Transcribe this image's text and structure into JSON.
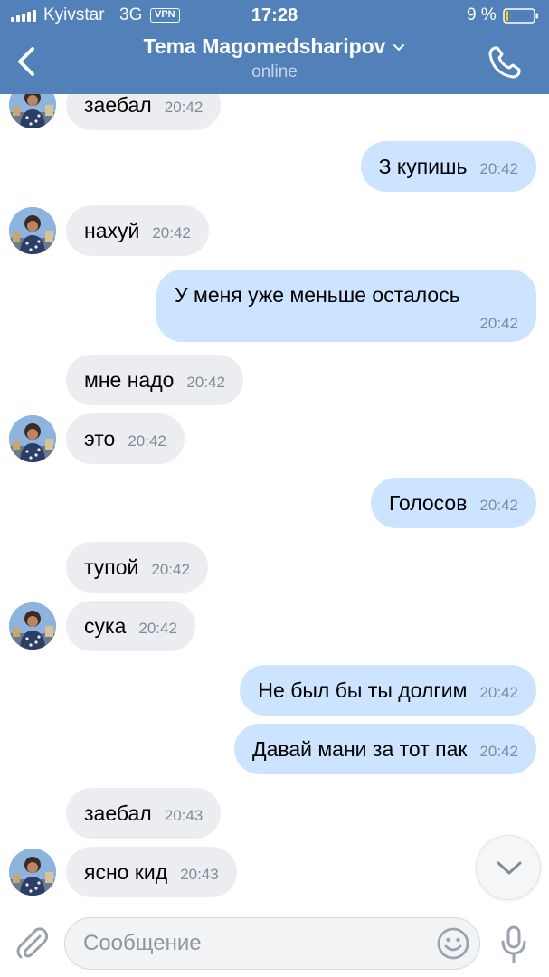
{
  "status_bar": {
    "carrier": "Kyivstar",
    "network": "3G",
    "vpn": "VPN",
    "time": "17:28",
    "battery": "9 %"
  },
  "header": {
    "contact_name": "Tema Magomedsharipov",
    "status": "online",
    "back_icon": "chevron-left-icon",
    "call_icon": "phone-icon"
  },
  "messages": [
    {
      "direction": "in",
      "text": "заебал",
      "time": "20:42",
      "avatar": true
    },
    {
      "direction": "out",
      "text": "З купишь",
      "time": "20:42"
    },
    {
      "direction": "in",
      "text": "нахуй",
      "time": "20:42",
      "avatar": true
    },
    {
      "direction": "out",
      "text": "У меня уже меньше осталось",
      "time": "20:42"
    },
    {
      "direction": "in",
      "text": "мне надо",
      "time": "20:42"
    },
    {
      "direction": "in",
      "text": "это",
      "time": "20:42",
      "avatar": true
    },
    {
      "direction": "out",
      "text": "Голосов",
      "time": "20:42"
    },
    {
      "direction": "in",
      "text": "тупой",
      "time": "20:42"
    },
    {
      "direction": "in",
      "text": "сука",
      "time": "20:42",
      "avatar": true
    },
    {
      "direction": "out",
      "text": "Не был бы ты долгим",
      "time": "20:42"
    },
    {
      "direction": "out",
      "text": "Давай мани за тот пак",
      "time": "20:42"
    },
    {
      "direction": "in",
      "text": "заебал",
      "time": "20:43"
    },
    {
      "direction": "in",
      "text": "ясно кид",
      "time": "20:43",
      "avatar": true
    }
  ],
  "composer": {
    "placeholder": "Сообщение",
    "value": ""
  },
  "colors": {
    "header_bg": "#5181b8",
    "incoming_bubble": "#ebedf0",
    "outgoing_bubble": "#cce4ff",
    "time_text": "#818c99"
  }
}
